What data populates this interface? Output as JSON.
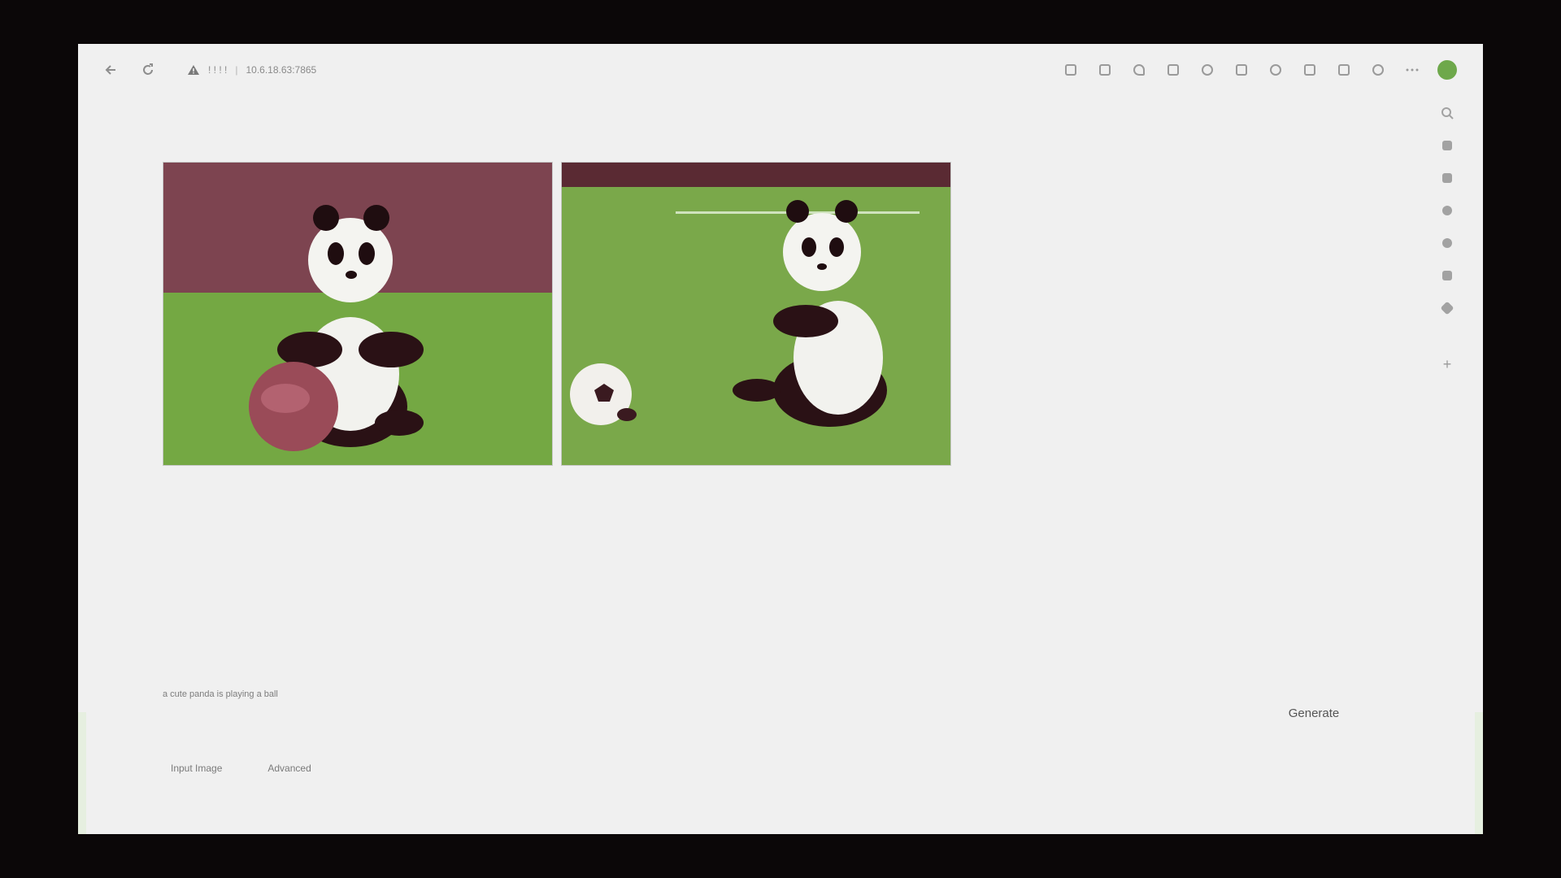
{
  "browser": {
    "address_warning": "! ! ! !",
    "address_separator": "|",
    "address_url": "10.6.18.63:7865"
  },
  "toolbar": {
    "extension_icons": [
      "translate-icon",
      "read-aloud-icon",
      "favorite-icon",
      "ext-1-icon",
      "ext-2-icon",
      "split-screen-icon",
      "favorites-icon",
      "collections-icon",
      "share-icon",
      "copilot-icon",
      "more-icon"
    ]
  },
  "sidebar": {
    "icons": [
      "search-icon",
      "tag-icon",
      "briefcase-icon",
      "people-icon",
      "circle-icon",
      "outlook-icon",
      "send-icon"
    ],
    "add_label": "+"
  },
  "gallery": {
    "images": [
      {
        "name": "panda-ball-image-1",
        "background": "#7d4450",
        "ground": "#74a843"
      },
      {
        "name": "panda-ball-image-2",
        "background": "#5a2a33",
        "ground": "#7aa84a"
      }
    ]
  },
  "prompt": {
    "text": "a cute panda is playing a ball"
  },
  "generate_label": "Generate",
  "tabs": [
    {
      "label": "Input Image"
    },
    {
      "label": "Advanced"
    }
  ],
  "colors": {
    "screen_bg": "#f0f0f0",
    "outer_bg": "#0b0708",
    "profile": "#6ea84b"
  }
}
